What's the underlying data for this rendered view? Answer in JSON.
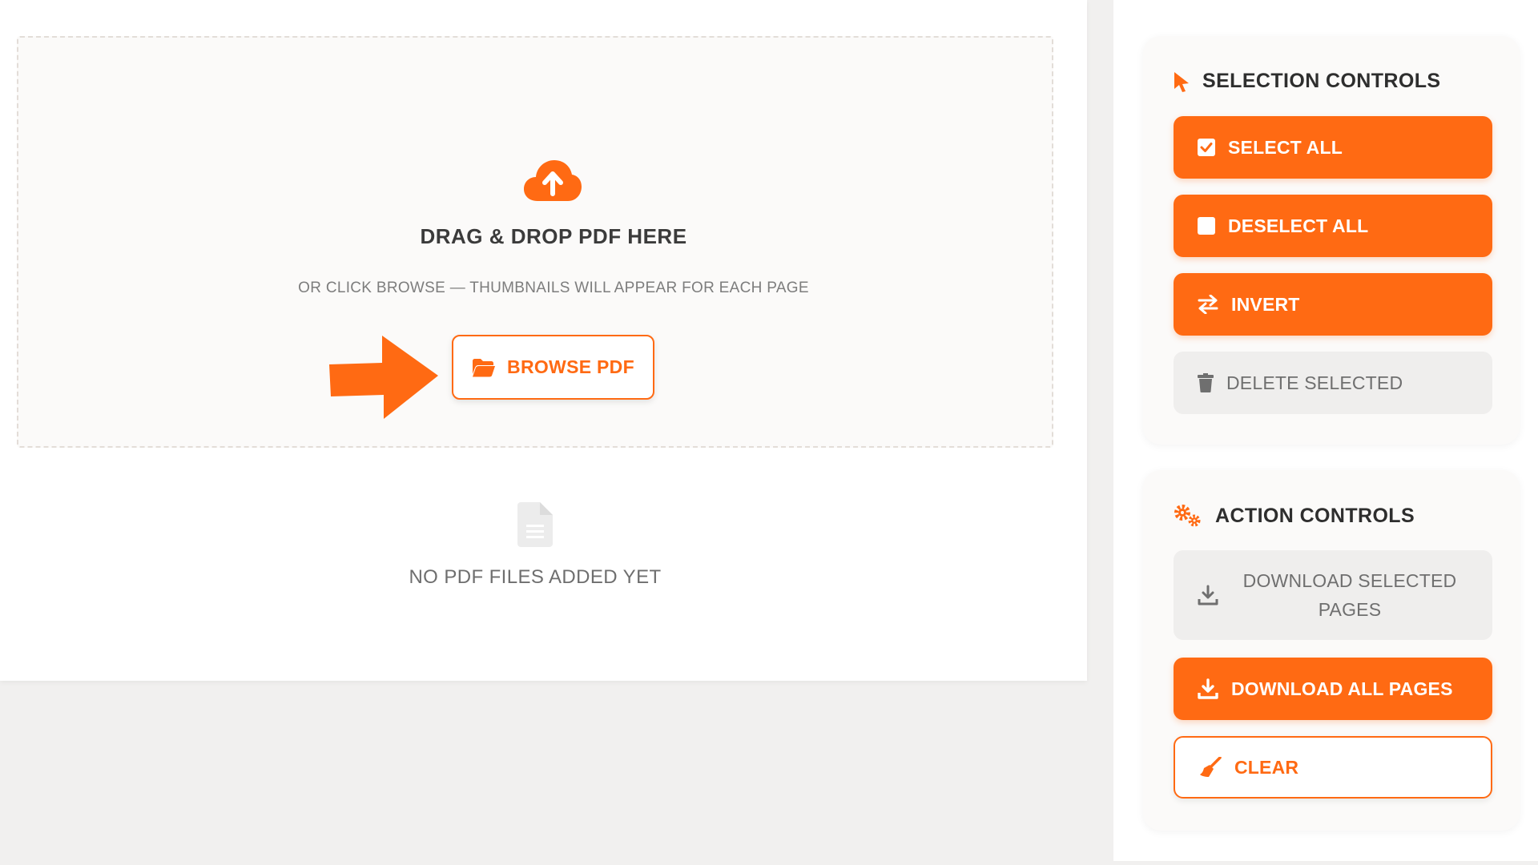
{
  "upload": {
    "title": "DRAG & DROP PDF HERE",
    "subtitle": "OR CLICK BROWSE — THUMBNAILS WILL APPEAR FOR EACH PAGE",
    "browse_label": "BROWSE PDF",
    "empty_text": "NO PDF FILES ADDED YET"
  },
  "selection_controls": {
    "title": "SELECTION CONTROLS",
    "buttons": [
      {
        "label": "SELECT ALL",
        "icon": "checked-box-icon"
      },
      {
        "label": "DESELECT ALL",
        "icon": "empty-box-icon"
      },
      {
        "label": "INVERT",
        "icon": "swap-arrows-icon"
      },
      {
        "label": "DELETE SELECTED",
        "icon": "trash-icon",
        "disabled": true
      }
    ]
  },
  "action_controls": {
    "title": "ACTION CONTROLS",
    "buttons": [
      {
        "label": "DOWNLOAD SELECTED PAGES",
        "icon": "download-icon",
        "disabled": true
      },
      {
        "label": "DOWNLOAD ALL PAGES",
        "icon": "download-icon"
      },
      {
        "label": "CLEAR",
        "icon": "broom-icon"
      }
    ]
  },
  "colors": {
    "accent": "#ff6a13",
    "disabled_bg": "#efeeed",
    "page_bg": "#f1f0ef"
  }
}
